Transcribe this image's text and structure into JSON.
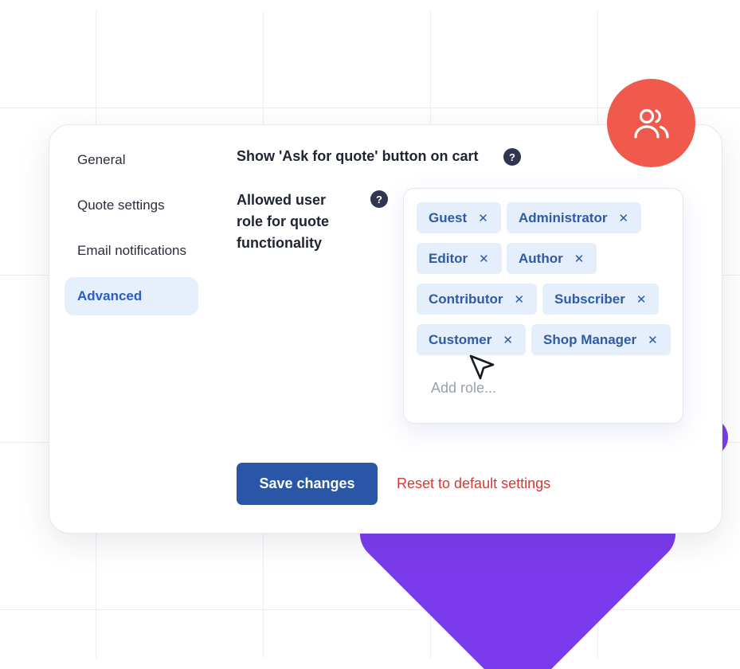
{
  "sidebar": {
    "items": [
      {
        "label": "General"
      },
      {
        "label": "Quote settings"
      },
      {
        "label": "Email notifications"
      },
      {
        "label": "Advanced"
      }
    ]
  },
  "settings": {
    "ask_quote_label": "Show 'Ask for quote' button on cart",
    "allowed_role_label": [
      "Allowed user",
      "role for quote",
      "functionality"
    ],
    "help_icon_glyph": "?"
  },
  "roles": {
    "tags": [
      {
        "label": "Guest"
      },
      {
        "label": "Administrator"
      },
      {
        "label": "Editor"
      },
      {
        "label": "Author"
      },
      {
        "label": "Contributor"
      },
      {
        "label": "Subscriber"
      },
      {
        "label": "Customer"
      },
      {
        "label": "Shop Manager"
      }
    ],
    "remove_glyph": "✕",
    "add_placeholder": "Add role..."
  },
  "actions": {
    "save_label": "Save changes",
    "reset_label": "Reset to default settings"
  },
  "icons": {
    "badge": "users-icon",
    "pointer": "cursor-arrow-icon"
  },
  "colors": {
    "accent": "#2a56a8",
    "active_nav_bg": "#e6f0fd",
    "badge_bg": "#ef5a4c",
    "decor_purple": "#7b3bec",
    "danger": "#d33a35"
  }
}
